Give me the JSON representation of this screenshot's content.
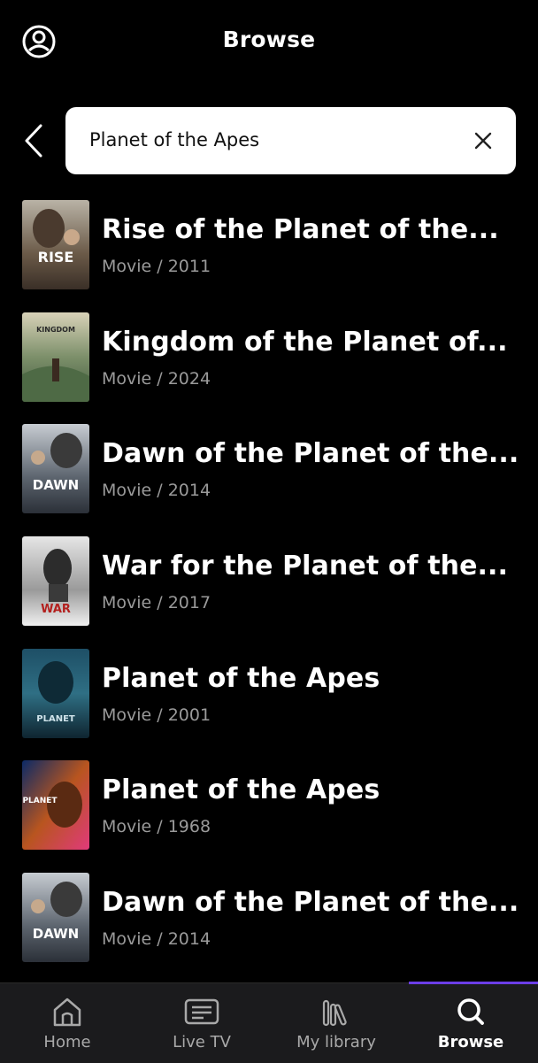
{
  "header": {
    "title": "Browse",
    "profile_icon": "user-circle-icon"
  },
  "search": {
    "back_icon": "chevron-left-icon",
    "query": "Planet of the Apes",
    "clear_icon": "close-icon"
  },
  "results": [
    {
      "title": "Rise of the Planet of the...",
      "meta": "Movie / 2011",
      "poster_text": "RISE"
    },
    {
      "title": "Kingdom of the Planet of...",
      "meta": "Movie / 2024",
      "poster_text": "KINGDOM"
    },
    {
      "title": "Dawn of the Planet of the...",
      "meta": "Movie / 2014",
      "poster_text": "DAWN"
    },
    {
      "title": "War for the Planet of the...",
      "meta": "Movie / 2017",
      "poster_text": "WAR"
    },
    {
      "title": "Planet of the Apes",
      "meta": "Movie / 2001",
      "poster_text": "PLANET"
    },
    {
      "title": "Planet of the Apes",
      "meta": "Movie / 1968",
      "poster_text": "PLANET"
    },
    {
      "title": "Dawn of the Planet of the...",
      "meta": "Movie / 2014",
      "poster_text": "DAWN"
    }
  ],
  "tabbar": {
    "items": [
      {
        "label": "Home",
        "icon": "home-icon",
        "active": false
      },
      {
        "label": "Live TV",
        "icon": "live-tv-icon",
        "active": false
      },
      {
        "label": "My library",
        "icon": "library-icon",
        "active": false
      },
      {
        "label": "Browse",
        "icon": "search-icon",
        "active": true
      }
    ]
  },
  "colors": {
    "background": "#000000",
    "tabbar_bg": "#1b1b1d",
    "accent": "#6c3ee8",
    "meta_text": "#9a9a9a"
  }
}
